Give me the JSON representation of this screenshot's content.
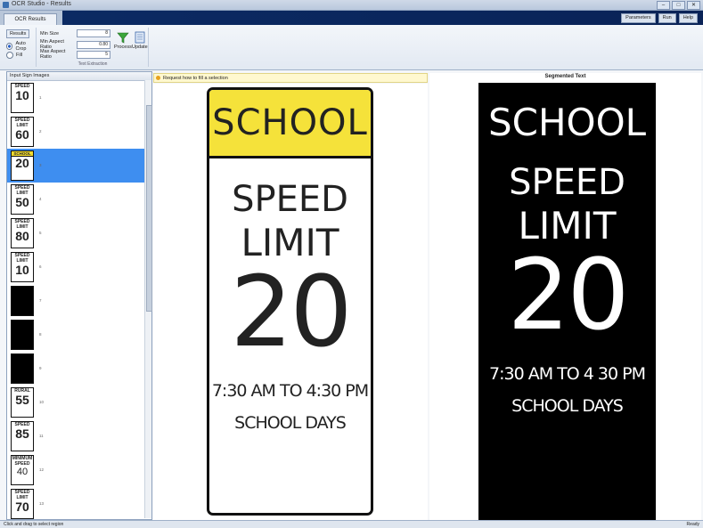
{
  "window": {
    "title": "OCR Studio - Results",
    "buttons": [
      "–",
      "□",
      "✕"
    ]
  },
  "tabs": {
    "active": "OCR Results",
    "right": [
      "Parameters",
      "Run",
      "Help"
    ]
  },
  "ribbon": {
    "radio1": "Results",
    "radio2": "Auto Crop",
    "radio3": "Fill",
    "spin1_label": "Min Size",
    "spin1_value": "8",
    "spin2_label": "Min Aspect Ratio",
    "spin2_value": "0.80",
    "spin3_label": "Max Aspect Ratio",
    "spin3_value": "5",
    "btn1": "Process",
    "btn2": "Update",
    "group_title": "Text Extraction"
  },
  "leftpanel": {
    "header": "Input Sign Images",
    "items": [
      {
        "top": "SPEED",
        "num": "10",
        "idx": "1"
      },
      {
        "top": "SPEED LIMIT",
        "num": "60",
        "idx": "2"
      },
      {
        "top": "SCHOOL",
        "num": "20",
        "idx": "3"
      },
      {
        "top": "SPEED LIMIT",
        "num": "50",
        "idx": "4"
      },
      {
        "top": "SPEED LIMIT",
        "num": "80",
        "idx": "5"
      },
      {
        "top": "SPEED LIMIT",
        "num": "10",
        "idx": "6"
      },
      {
        "top": "",
        "num": "",
        "idx": "7"
      },
      {
        "top": "",
        "num": "",
        "idx": "8"
      },
      {
        "top": "",
        "num": "",
        "idx": "9"
      },
      {
        "top": "RURAL",
        "num": "55",
        "idx": "10"
      },
      {
        "top": "SPEED",
        "num": "85",
        "idx": "11"
      },
      {
        "top": "MINIMUM SPEED",
        "num": "40",
        "idx": "12"
      },
      {
        "top": "SPEED LIMIT",
        "num": "70",
        "idx": "13"
      }
    ]
  },
  "info": "Request how to fill a selection",
  "segmented_title": "Segmented Text",
  "sign": {
    "header": "SCHOOL",
    "line1": "SPEED",
    "line2": "LIMIT",
    "number": "20",
    "time": "7:30 AM TO 4:30 PM",
    "days": "SCHOOL DAYS"
  },
  "segsign": {
    "header": "SCHOOL",
    "line1": "SPEED",
    "line2": "LIMIT",
    "number": "20",
    "time": "7:30 AM TO 4 30 PM",
    "days": "SCHOOL DAYS"
  },
  "status": {
    "left": "Click and drag to select region",
    "right": "Ready"
  },
  "colors": {
    "selection": "#3e8ef0",
    "sign_yellow": "#f5e23a",
    "tabbar_dark": "#0b2a63"
  }
}
